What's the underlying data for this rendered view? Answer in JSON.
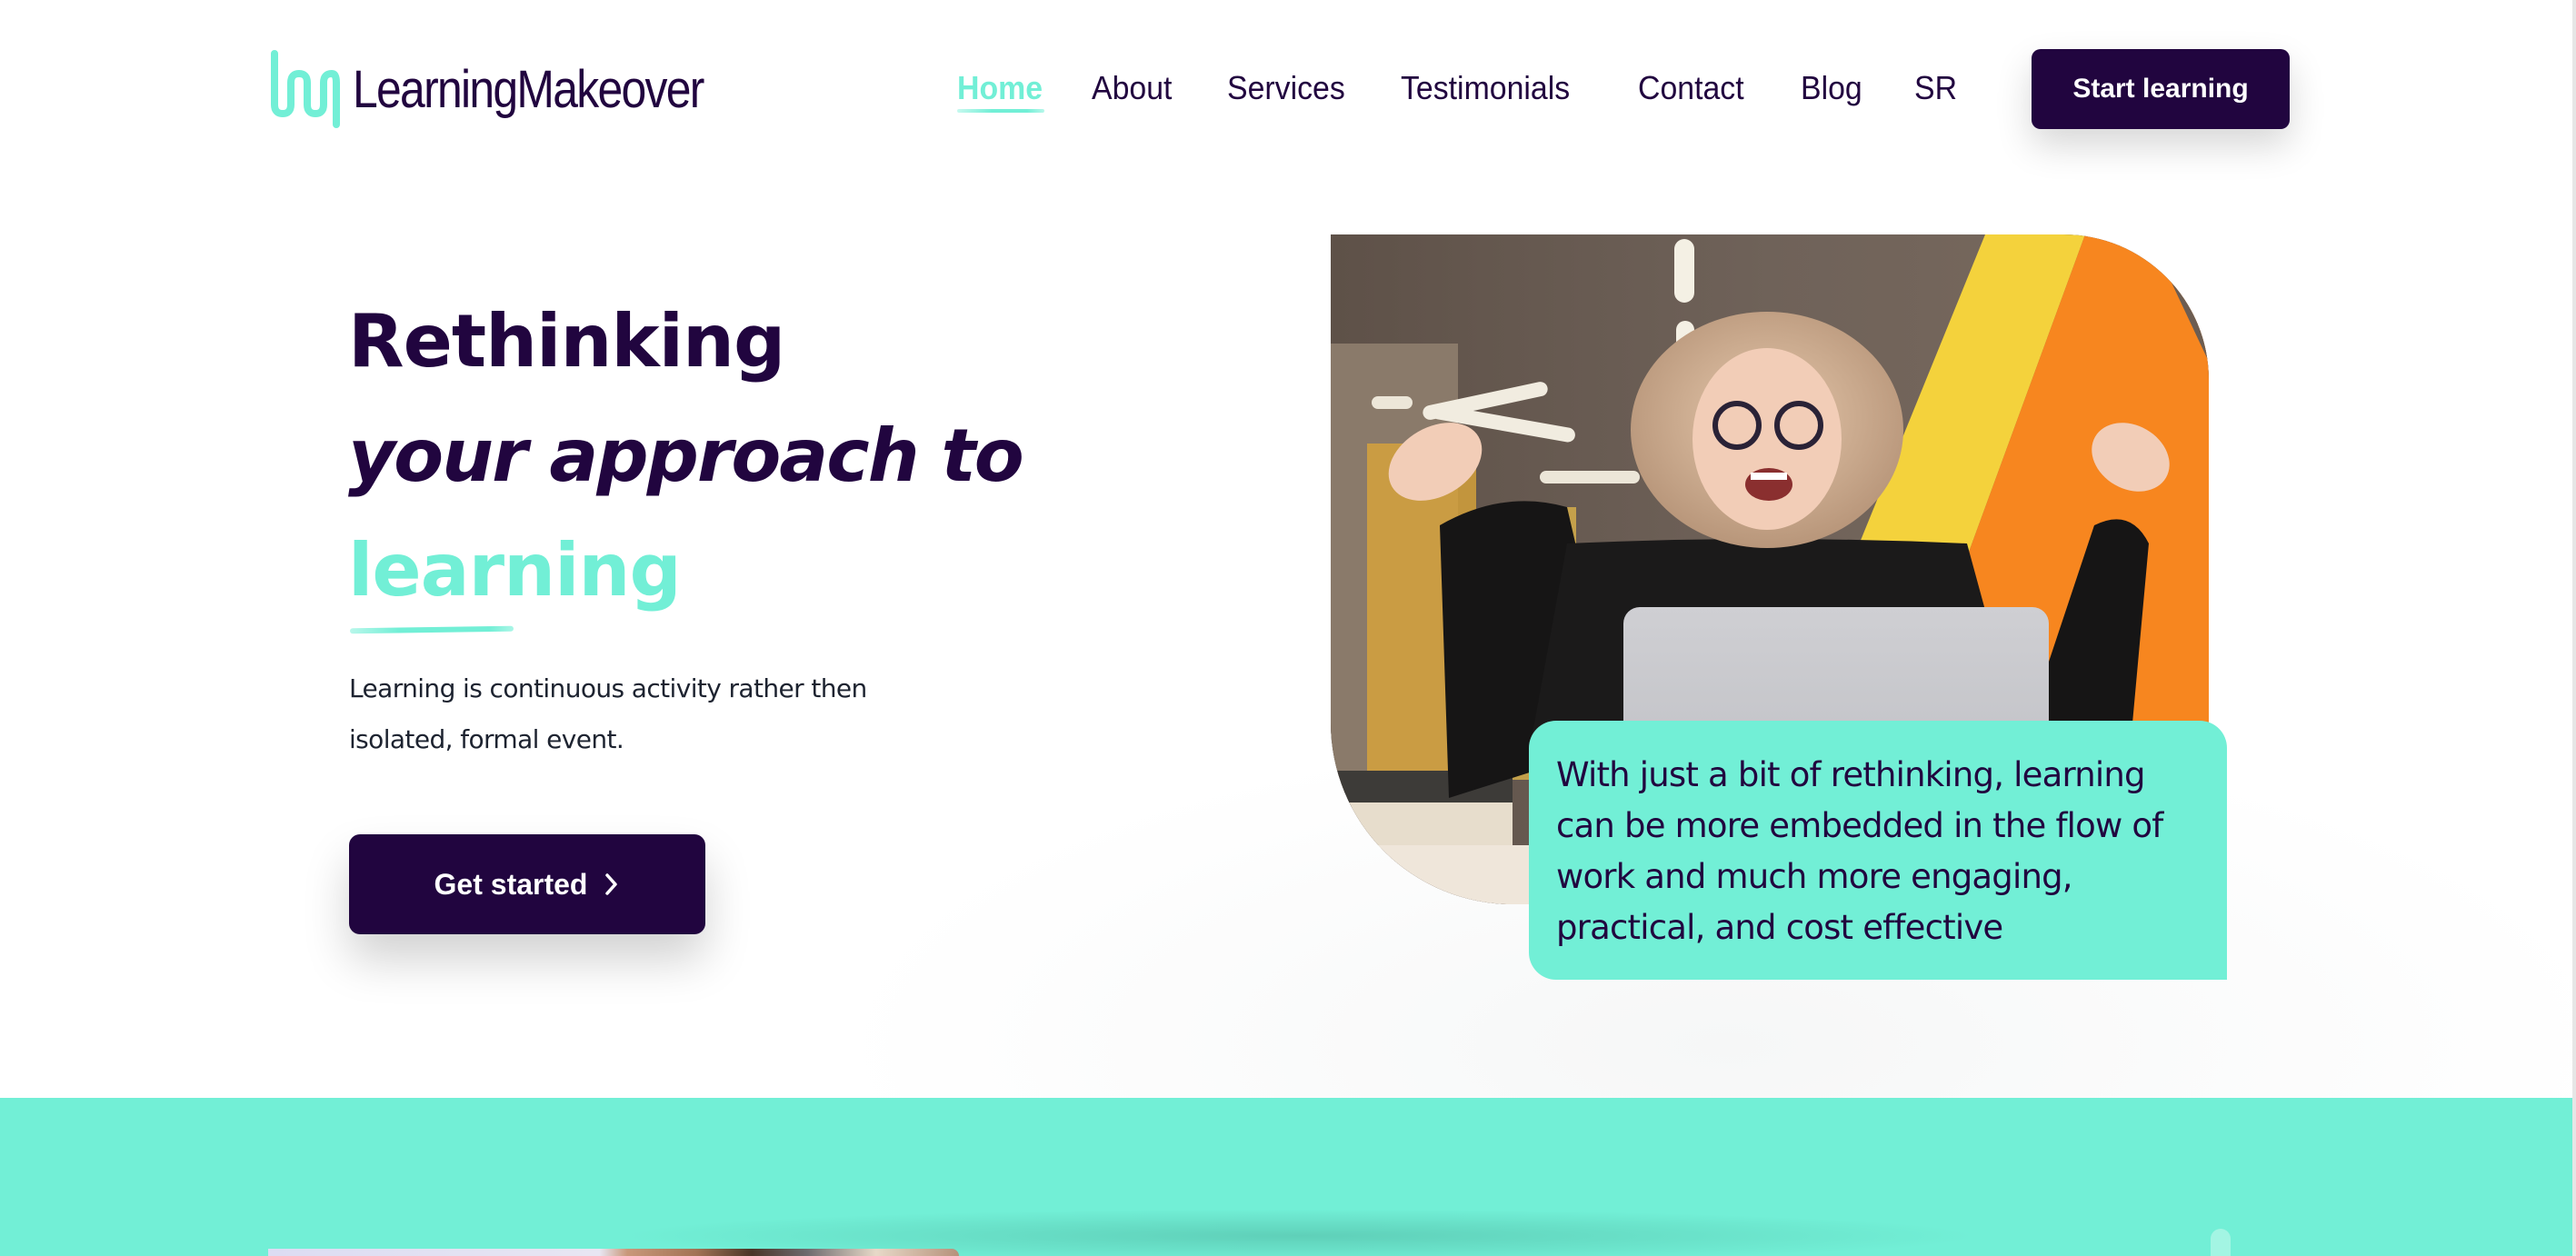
{
  "brand": {
    "name": "LearningMakeover",
    "logo_icon": "wave-line-logo-icon",
    "colors": {
      "primary": "#21053f",
      "accent": "#72efd6",
      "text": "#1d2330",
      "background": "#ffffff"
    }
  },
  "nav": {
    "items": [
      {
        "label": "Home",
        "active": true
      },
      {
        "label": "About",
        "active": false
      },
      {
        "label": "Services",
        "active": false
      },
      {
        "label": "Testimonials",
        "active": false
      },
      {
        "label": "Contact",
        "active": false
      },
      {
        "label": "Blog",
        "active": false
      },
      {
        "label": "SR",
        "active": false
      }
    ],
    "cta_label": "Start learning"
  },
  "hero": {
    "headline_line1": "Rethinking",
    "headline_line2": "your approach to",
    "headline_line3": "learning",
    "subtitle": "Learning is continuous activity rather then isolated, formal event.",
    "cta_label": "Get started",
    "cta_icon": "chevron-right-icon",
    "image_alt": "Excited woman with glasses raising hands behind a laptop",
    "caption": "With just a bit of rethinking, learning can be more embedded in the flow of work and much more engaging, practical, and cost effective"
  }
}
